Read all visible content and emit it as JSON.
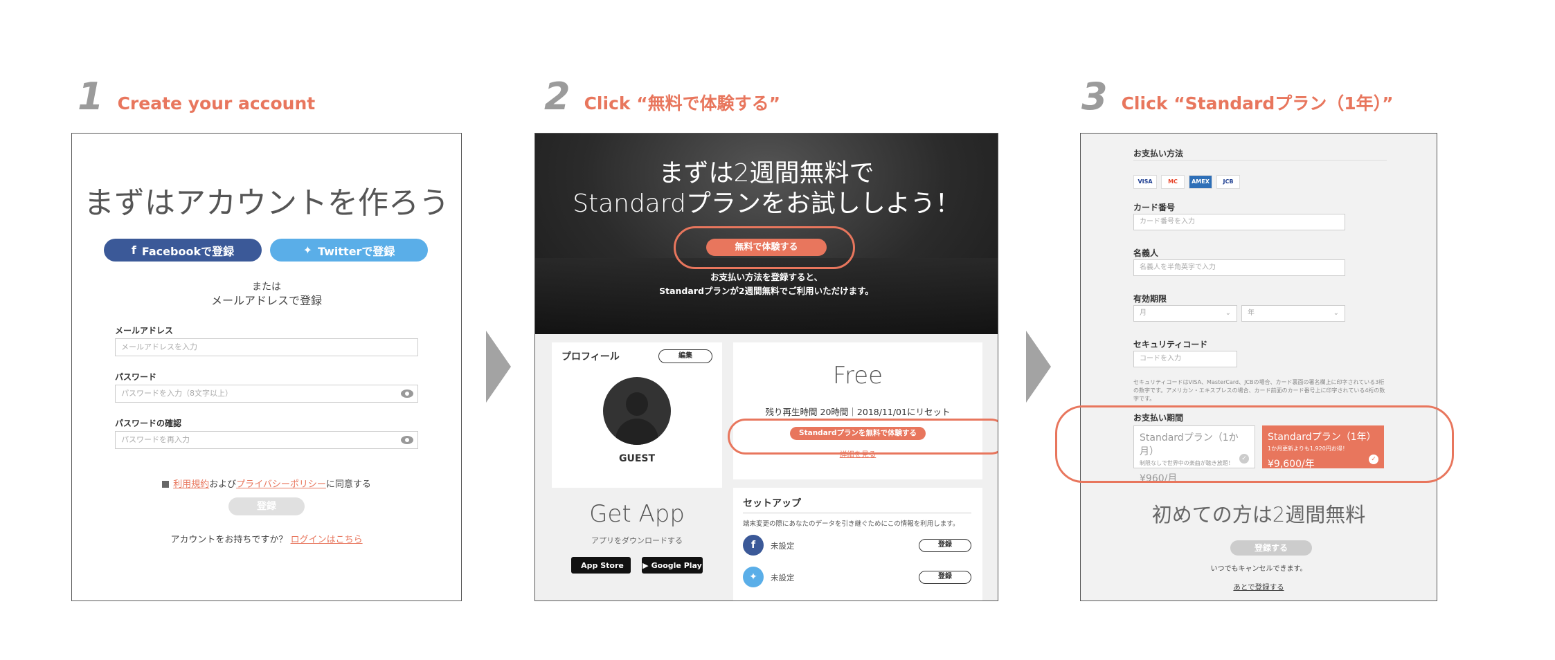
{
  "steps": [
    {
      "number": "1",
      "title": "Create  your account"
    },
    {
      "number": "2",
      "title": "Click “無料で体験する”"
    },
    {
      "number": "3",
      "title": "Click “Standardプラン（1年）”"
    }
  ],
  "panel1": {
    "title": "まずはアカウントを作ろう",
    "facebook_btn": "Facebookで登録",
    "twitter_btn": "Twitterで登録",
    "or_line1": "または",
    "or_line2": "メールアドレスで登録",
    "email_label": "メールアドレス",
    "email_placeholder": "メールアドレスを入力",
    "password_label": "パスワード",
    "password_placeholder": "パスワードを入力（8文字以上）",
    "confirm_label": "パスワードの確認",
    "confirm_placeholder": "パスワードを再入力",
    "terms_link": "利用規約",
    "and_text": "および",
    "privacy_link": "プライバシーポリシー",
    "agree_text": "に同意する",
    "register_btn": "登録",
    "have_account": "アカウントをお持ちですか？",
    "login_link": "ログインはこちら"
  },
  "panel2": {
    "hero_line1": "まずは2週間無料で",
    "hero_line2": "Standardプランをお試ししよう！",
    "hero_btn": "無料で体験する",
    "hero_note1": "お支払い方法を登録すると、",
    "hero_note2": "Standardプランが2週間無料でご利用いただけます。",
    "profile_title": "プロフィール",
    "edit_btn": "編集",
    "guest": "GUEST",
    "plan_name": "Free",
    "plan_note": "残り再生時間 20時間｜2018/11/01にリセット",
    "standard_btn": "Standardプランを無料で体験する",
    "details_link": "詳細を見る",
    "get_app": "Get App",
    "download_text": "アプリをダウンロードする",
    "app_store": "App Store",
    "google_play": "Google Play",
    "setup_title": "セットアップ",
    "setup_desc": "端末変更の際にあなたのデータを引き継ぐためにこの情報を利用します。",
    "fb_status": "未設定",
    "tw_status": "未設定",
    "register_btn": "登録"
  },
  "panel3": {
    "payment_method": "お支払い方法",
    "card_brands": [
      "VISA",
      "MC",
      "AMEX",
      "JCB"
    ],
    "card_number_label": "カード番号",
    "card_number_placeholder": "カード番号を入力",
    "holder_label": "名義人",
    "holder_placeholder": "名義人を半角英字で入力",
    "expiry_label": "有効期限",
    "month_placeholder": "月",
    "year_placeholder": "年",
    "security_label": "セキュリティコード",
    "security_placeholder": "コードを入力",
    "security_note": "セキュリティコードはVISA、MasterCard、JCBの場合、カード裏面の署名欄上に印字されている3桁の数字です。アメリカン・エキスプレスの場合、カード前面のカード番号上に印字されている4桁の数字です。",
    "period_label": "お支払い期間",
    "monthly_name": "Standardプラン（1か月）",
    "monthly_sub": "制限なしで世界中の楽曲が聴き放題！",
    "monthly_price": "¥960/月",
    "yearly_name": "Standardプラン（1年）",
    "yearly_sub": "1か月更新よりも1,920円お得！",
    "yearly_price": "¥9,600/年",
    "trial_text": "初めての方は2週間無料",
    "register_btn": "登録する",
    "cancel_text": "いつでもキャンセルできます。",
    "later_link": "あとで登録する"
  },
  "colors": {
    "accent": "#e8765d",
    "facebook": "#3b5998",
    "twitter": "#5aaee8",
    "arrow": "#a3a3a3"
  }
}
